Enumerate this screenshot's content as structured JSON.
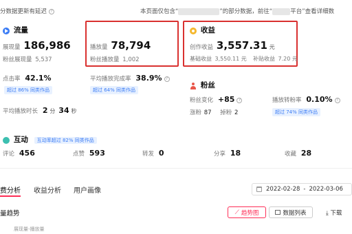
{
  "notice": {
    "left_text": "分数据更新有延迟",
    "right_part1": "本页面仅包含“",
    "right_part2": "”的部分数据，前往“",
    "right_part3": "平台”查看详细数"
  },
  "flow": {
    "title": "流量",
    "views_label": "展现量",
    "views_value": "186,986",
    "fan_views_label": "粉丝展现量",
    "fan_views_value": "5,537",
    "plays_label": "播放量",
    "plays_value": "78,794",
    "fan_plays_label": "粉丝播放量",
    "fan_plays_value": "1,002",
    "ctr_label": "点击率",
    "ctr_value": "42.1%",
    "ctr_badge": "超过 86% 同类作品",
    "completion_label": "平均播放完成率",
    "completion_value": "38.9%",
    "completion_badge": "超过 64% 同类作品",
    "avg_duration_label": "平均播放时长",
    "avg_duration_min": "2",
    "avg_duration_min_unit": "分",
    "avg_duration_sec": "34",
    "avg_duration_sec_unit": "秒"
  },
  "income": {
    "title": "收益",
    "creation_label": "创作收益",
    "creation_value": "3,557.31",
    "creation_unit": "元",
    "base_label": "基础收益",
    "base_value": "3,550.11",
    "base_unit": "元",
    "subsidy_label": "补贴收益",
    "subsidy_value": "7.20",
    "subsidy_unit": "元"
  },
  "fans": {
    "title": "粉丝",
    "change_label": "粉丝变化",
    "change_value": "+85",
    "rise_label": "涨粉",
    "rise_value": "87",
    "drop_label": "掉粉",
    "drop_value": "2",
    "convert_label": "播放转粉率",
    "convert_value": "0.10%",
    "convert_badge": "超过 74% 同类作品"
  },
  "interact": {
    "title": "互动",
    "badge": "互动率超过 82% 同类作品",
    "comment_label": "评论",
    "comment_value": "456",
    "like_label": "点赞",
    "like_value": "593",
    "forward_label": "转发",
    "forward_value": "0",
    "share_label": "分享",
    "share_value": "18",
    "collect_label": "收藏",
    "collect_value": "28"
  },
  "tabs": [
    "费分析",
    "收益分析",
    "用户画像"
  ],
  "date_range": {
    "start": "2022-02-28",
    "sep": "-",
    "end": "2022-03-06"
  },
  "trend": {
    "title": "量趋势",
    "legend": "展现量-播放量",
    "chart_btn": "趋势图",
    "list_btn": "数据列表",
    "download_btn": "下载"
  },
  "colors": {
    "accent": "#fe2c55",
    "highlight_border": "#d9302f",
    "badge_text": "#3b7cf5"
  }
}
